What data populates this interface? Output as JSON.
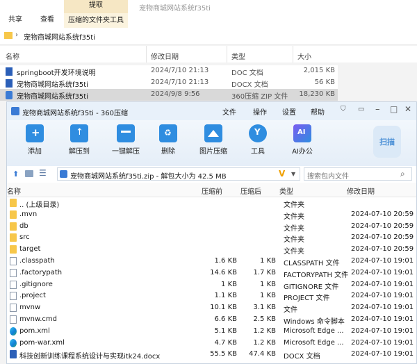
{
  "ribbon": {
    "tabs": [
      "共享",
      "查看"
    ],
    "context_header": "提取",
    "context_tab": "压缩的文件夹工具",
    "window_title": "宠物商城网站系统f35ti"
  },
  "address": {
    "path": "宠物商城网站系统f35ti"
  },
  "explorer": {
    "columns": {
      "name": "名称",
      "date": "修改日期",
      "type": "类型",
      "size": "大小"
    },
    "rows": [
      {
        "name": "springboot开发环境说明",
        "date": "2024/7/10 21:13",
        "type": "DOC 文档",
        "size": "2,015 KB"
      },
      {
        "name": "宠物商城网站系统f35ti",
        "date": "2024/7/10 21:13",
        "type": "DOCX 文档",
        "size": "56 KB"
      },
      {
        "name": "宠物商城网站系统f35ti",
        "date": "2024/9/8 9:56",
        "type": "360压缩 ZIP 文件",
        "size": "18,230 KB"
      }
    ]
  },
  "zip_window": {
    "title": "宠物商城网站系统f35ti - 360压缩",
    "menu": [
      "文件",
      "操作",
      "设置",
      "帮助"
    ],
    "tools": [
      "添加",
      "解压到",
      "一键解压",
      "删除",
      "图片压缩",
      "工具",
      "AI办公"
    ],
    "scan_label": "扫描",
    "path_text": "宠物商城网站系统f35ti.zip - 解包大小为 42.5 MB",
    "search_placeholder": "搜索包内文件",
    "columns": {
      "name": "名称",
      "compressed": "压缩前",
      "after": "压缩后",
      "type": "类型",
      "modified": "修改日期"
    },
    "files": [
      {
        "name": ".. (上级目录)",
        "compressed": "",
        "after": "",
        "type": "文件夹",
        "modified": "",
        "icon": "folder"
      },
      {
        "name": ".mvn",
        "compressed": "",
        "after": "",
        "type": "文件夹",
        "modified": "2024-07-10 20:59",
        "icon": "folder"
      },
      {
        "name": "db",
        "compressed": "",
        "after": "",
        "type": "文件夹",
        "modified": "2024-07-10 20:59",
        "icon": "folder"
      },
      {
        "name": "src",
        "compressed": "",
        "after": "",
        "type": "文件夹",
        "modified": "2024-07-10 20:59",
        "icon": "folder"
      },
      {
        "name": "target",
        "compressed": "",
        "after": "",
        "type": "文件夹",
        "modified": "2024-07-10 20:59",
        "icon": "folder"
      },
      {
        "name": ".classpath",
        "compressed": "1.6 KB",
        "after": "1 KB",
        "type": "CLASSPATH 文件",
        "modified": "2024-07-10 19:01",
        "icon": "doc"
      },
      {
        "name": ".factorypath",
        "compressed": "14.6 KB",
        "after": "1.7 KB",
        "type": "FACTORYPATH 文件",
        "modified": "2024-07-10 19:01",
        "icon": "doc"
      },
      {
        "name": ".gitignore",
        "compressed": "1 KB",
        "after": "1 KB",
        "type": "GITIGNORE 文件",
        "modified": "2024-07-10 19:01",
        "icon": "doc"
      },
      {
        "name": ".project",
        "compressed": "1.1 KB",
        "after": "1 KB",
        "type": "PROJECT 文件",
        "modified": "2024-07-10 19:01",
        "icon": "doc"
      },
      {
        "name": "mvnw",
        "compressed": "10.1 KB",
        "after": "3.1 KB",
        "type": "文件",
        "modified": "2024-07-10 19:01",
        "icon": "doc"
      },
      {
        "name": "mvnw.cmd",
        "compressed": "6.6 KB",
        "after": "2.5 KB",
        "type": "Windows 命令脚本",
        "modified": "2024-07-10 19:01",
        "icon": "doc"
      },
      {
        "name": "pom.xml",
        "compressed": "5.1 KB",
        "after": "1.2 KB",
        "type": "Microsoft Edge ...",
        "modified": "2024-07-10 19:01",
        "icon": "edge"
      },
      {
        "name": "pom-war.xml",
        "compressed": "4.7 KB",
        "after": "1.2 KB",
        "type": "Microsoft Edge ...",
        "modified": "2024-07-10 19:01",
        "icon": "edge"
      },
      {
        "name": "科技创新训练课程系统设计与实现itk24.docx",
        "compressed": "55.5 KB",
        "after": "47.4 KB",
        "type": "DOCX 文档",
        "modified": "2024-07-10 19:01",
        "icon": "word"
      }
    ]
  }
}
